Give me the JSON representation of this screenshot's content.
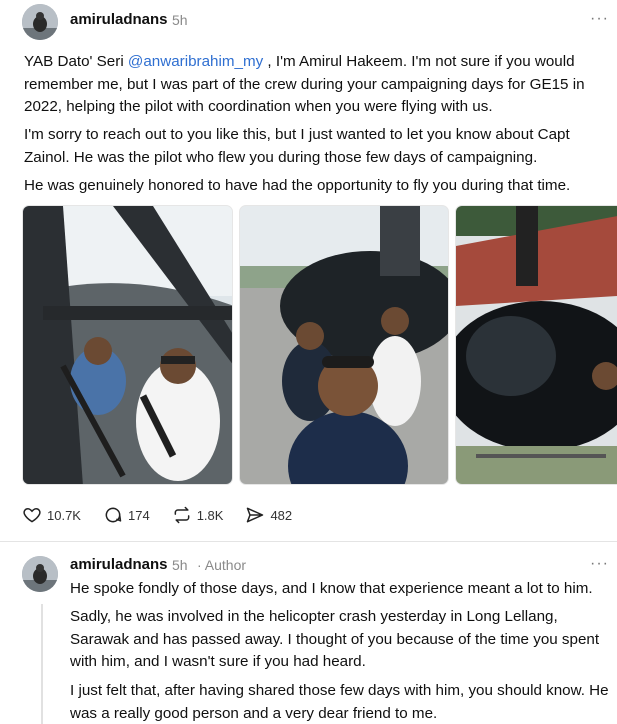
{
  "post": {
    "username": "amiruladnans",
    "time": "5h",
    "more_label": "···",
    "mention": "@anwaribrahim_my",
    "para1_before": "YAB Dato' Seri ",
    "para1_after": " , I'm Amirul Hakeem. I'm not sure if you would remember me, but I was part of the crew during your campaigning days for GE15 in 2022, helping the pilot with coordination when you were flying with us.",
    "para2": "I'm sorry to reach out to you like this, but I just wanted to let you know about Capt Zainol. He was the pilot who flew you during those few days of campaigning.",
    "para3": "He was genuinely honored to have had the opportunity to fly you during that time.",
    "photos": [
      {
        "icon": "cockpit-photo"
      },
      {
        "icon": "group-selfie-photo"
      },
      {
        "icon": "helicopter-photo"
      }
    ],
    "actions": {
      "likes": "10.7K",
      "comments": "174",
      "reposts": "1.8K",
      "shares": "482"
    }
  },
  "reply": {
    "username": "amiruladnans",
    "time": "5h",
    "author_tag": "· Author",
    "more_label": "···",
    "para1": "He spoke fondly of those days, and I know that experience meant a lot to him.",
    "para2": "Sadly, he was involved in the helicopter crash yesterday in Long Lellang, Sarawak and has passed away. I thought of you because of the time you spent with him, and I wasn't sure if you had heard.",
    "para3": "I just felt that, after having shared those few days with him, you should know. He was a really good person and a very dear friend to me."
  }
}
